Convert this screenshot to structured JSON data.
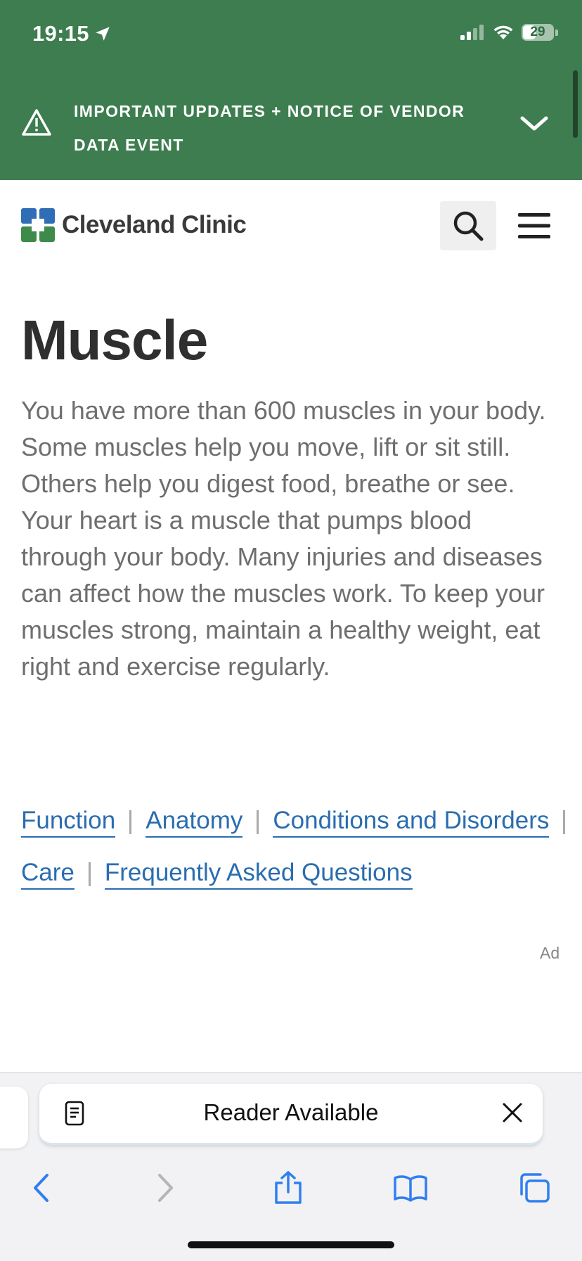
{
  "status_bar": {
    "time": "19:15",
    "battery": "29",
    "icons": [
      "location-arrow-icon",
      "signal-icon",
      "wifi-icon",
      "battery-icon"
    ]
  },
  "notice": {
    "text": "IMPORTANT UPDATES + NOTICE OF VENDOR DATA EVENT",
    "icons": [
      "warning-triangle-icon",
      "chevron-down-icon"
    ]
  },
  "header": {
    "logo_text": "Cleveland Clinic",
    "icons": [
      "cleveland-clinic-logo-icon",
      "search-icon",
      "hamburger-menu-icon"
    ]
  },
  "article": {
    "title": "Muscle",
    "intro": "You have more than 600 muscles in your body. Some muscles help you move, lift or sit still. Others help you digest food, breathe or see. Your heart is a muscle that pumps blood through your body. Many injuries and diseases can affect how the muscles work. To keep your muscles strong, maintain a healthy weight, eat right and exercise regularly."
  },
  "toc": {
    "links": [
      {
        "label": "Function"
      },
      {
        "label": "Anatomy"
      },
      {
        "label": "Conditions and Disorders"
      },
      {
        "label": "Care"
      },
      {
        "label": "Frequently Asked Questions"
      }
    ]
  },
  "ad": {
    "label": "Ad"
  },
  "safari": {
    "reader_label": "Reader Available",
    "toolbar_icons": [
      "back-icon",
      "forward-icon",
      "share-icon",
      "bookmarks-icon",
      "tabs-icon"
    ]
  },
  "colors": {
    "brand_green": "#3d7d4f",
    "link_blue": "#2a6db0",
    "text_gray": "#6e6e6e"
  }
}
